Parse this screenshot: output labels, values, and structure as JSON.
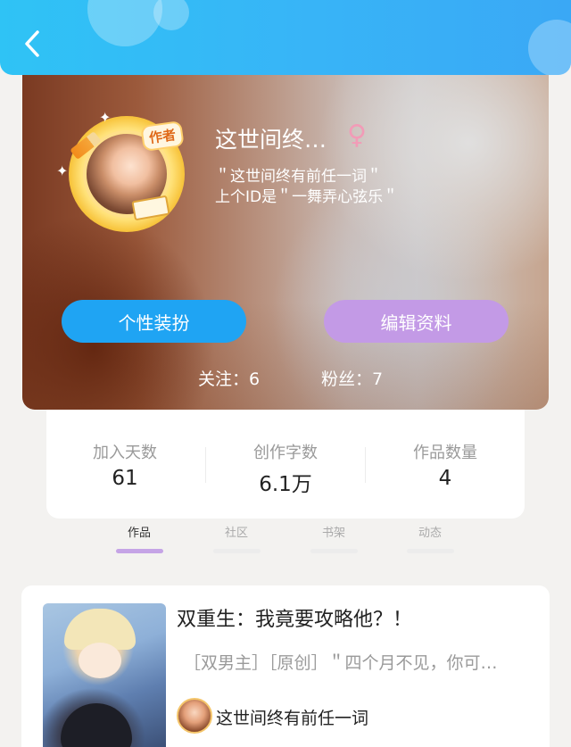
{
  "header": {
    "back_icon": "chevron-left-icon",
    "accent_color": "#38b4f7"
  },
  "profile": {
    "author_badge": "作者",
    "username": "这世间终…",
    "gender_icon": "♀",
    "bio_line1": "＂这世间终有前任一词＂",
    "bio_line2": "上个ID是＂一舞弄心弦乐＂",
    "dress_button": "个性装扮",
    "edit_button": "编辑资料",
    "following": "关注：6",
    "fans": "粉丝：7",
    "dress_button_color": "#1fa4f3",
    "edit_button_color": "#c39ae6"
  },
  "stats": [
    {
      "label": "加入天数",
      "value": "61"
    },
    {
      "label": "创作字数",
      "value": "6.1万"
    },
    {
      "label": "作品数量",
      "value": "4"
    }
  ],
  "tabs": [
    {
      "label": "作品",
      "active": true
    },
    {
      "label": "社区",
      "active": false
    },
    {
      "label": "书架",
      "active": false
    },
    {
      "label": "动态",
      "active": false
    }
  ],
  "works": [
    {
      "title": "双重生：我竟要攻略他？！",
      "tags": "［双男主］［原创］＂四个月不见，你可…",
      "author": "这世间终有前任一词"
    }
  ]
}
